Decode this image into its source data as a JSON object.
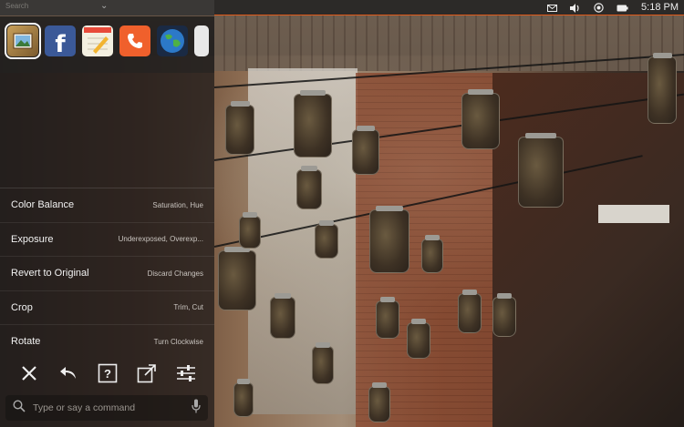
{
  "panel": {
    "dash_label": "Search",
    "clock": "5:18 PM",
    "indicators": [
      "mail-icon",
      "volume-icon",
      "network-icon",
      "battery-icon"
    ]
  },
  "launcher": {
    "apps": [
      {
        "name": "shotwell-icon",
        "selected": true
      },
      {
        "name": "facebook-icon",
        "letter": "f"
      },
      {
        "name": "notes-icon"
      },
      {
        "name": "phone-icon"
      },
      {
        "name": "globe-icon"
      },
      {
        "name": "partial-app-icon"
      }
    ]
  },
  "hud": {
    "actions": [
      {
        "title": "Color Balance",
        "desc": "Saturation, Hue"
      },
      {
        "title": "Exposure",
        "desc": "Underexposed, Overexp..."
      },
      {
        "title": "Revert to Original",
        "desc": "Discard Changes"
      },
      {
        "title": "Crop",
        "desc": "Trim, Cut"
      },
      {
        "title": "Rotate",
        "desc": "Turn Clockwise"
      }
    ],
    "toolbar": [
      "close-icon",
      "undo-icon",
      "help-icon",
      "fullscreen-icon",
      "settings-icon"
    ],
    "search": {
      "placeholder": "Type or say a command",
      "value": ""
    }
  },
  "colors": {
    "accent": "#e05a1a",
    "panel": "#2c2a28",
    "hud": "#221e1c"
  }
}
